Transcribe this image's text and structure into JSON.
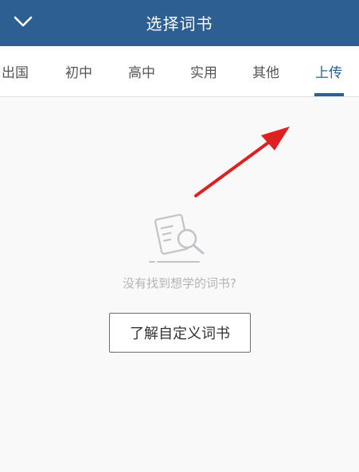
{
  "header": {
    "title": "选择词书",
    "back_icon": "chevron-down-icon",
    "background": "#2d5f92"
  },
  "tabs": {
    "items": [
      {
        "label": "出国",
        "active": false
      },
      {
        "label": "初中",
        "active": false
      },
      {
        "label": "高中",
        "active": false
      },
      {
        "label": "实用",
        "active": false
      },
      {
        "label": "其他",
        "active": false
      },
      {
        "label": "上传",
        "active": true
      }
    ],
    "active_color": "#2d5f92"
  },
  "empty_state": {
    "icon": "document-search-icon",
    "message": "没有找到想学的词书?",
    "button_label": "了解自定义词书"
  },
  "annotation": {
    "arrow_color": "#e02020",
    "arrow_icon": "red-arrow-icon"
  }
}
